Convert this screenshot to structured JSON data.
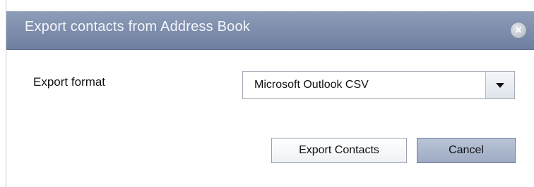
{
  "dialog": {
    "title": "Export contacts from Address Book",
    "close_icon": "close-x-icon"
  },
  "form": {
    "format_label": "Export format",
    "format_selected": "Microsoft Outlook CSV",
    "dropdown_icon": "chevron-down-icon"
  },
  "buttons": {
    "export_label": "Export Contacts",
    "cancel_label": "Cancel"
  },
  "colors": {
    "titlebar": "#7d8cab",
    "title_text": "#f3f5fa",
    "cancel_button": "#a9b5ca"
  }
}
